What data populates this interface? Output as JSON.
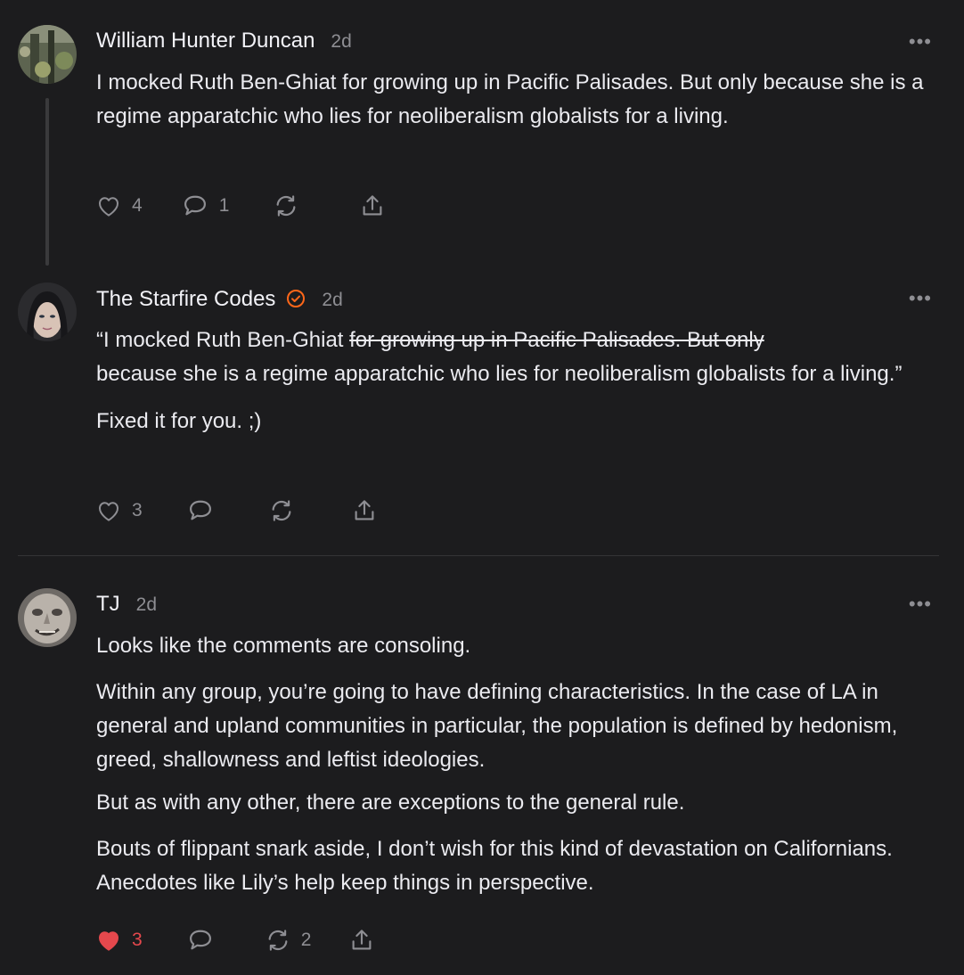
{
  "colors": {
    "background": "#1c1c1e",
    "text": "#ebebf0",
    "muted": "#8e8e93",
    "liked": "#e5484d",
    "verified": "#ff6719"
  },
  "comments": [
    {
      "author": "William Hunter Duncan",
      "time": "2d",
      "more": "•••",
      "paragraphs": [
        "I mocked Ruth Ben-Ghiat for growing up in Pacific Palisades. But only because she is a regime apparatchic who lies for neoliberalism globalists for a living."
      ],
      "likes": "4",
      "replies": "1",
      "restacks": "",
      "liked": false
    },
    {
      "author": "The Starfire Codes",
      "verified": true,
      "time": "2d",
      "more": "•••",
      "quote_prefix": "“I mocked Ruth Ben-Ghiat ",
      "quote_struck": "for growing up in Pacific Palisades. But only",
      "quote_rest": "because she is a regime apparatchic who lies for neoliberalism globalists for a living.”",
      "paragraphs": [
        "Fixed it for you. ;)"
      ],
      "likes": "3",
      "replies": "",
      "restacks": "",
      "liked": false
    },
    {
      "author": "TJ",
      "time": "2d",
      "more": "•••",
      "paragraphs": [
        "Looks like the comments are consoling.",
        "Within any group, you’re going to have defining characteristics. In the case of LA in general and upland communities in particular, the population is defined by hedonism, greed, shallowness and leftist ideologies.",
        "But as with any other, there are exceptions to the general rule.",
        "Bouts of flippant snark aside, I don’t wish for this kind of devastation on Californians. Anecdotes like Lily’s help keep things in perspective."
      ],
      "likes": "3",
      "replies": "",
      "restacks": "2",
      "liked": true
    }
  ]
}
